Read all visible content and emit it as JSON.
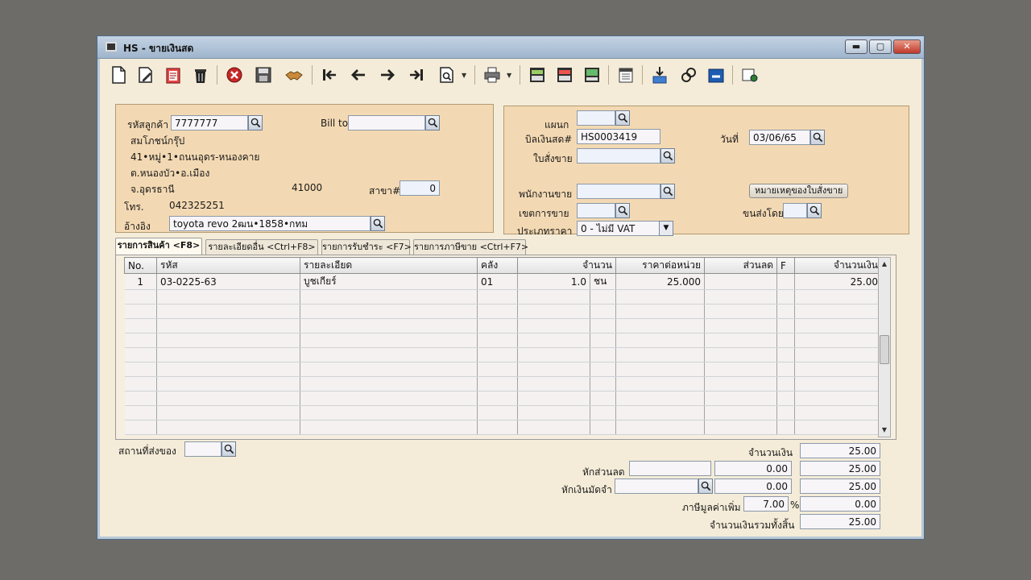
{
  "window": {
    "title": "HS - ขายเงินสด",
    "min_label": "▬",
    "max_label": "▢",
    "close_label": "✕"
  },
  "toolbar": {
    "icons": [
      "new-doc-icon",
      "edit-icon",
      "clipboard-icon",
      "trash-icon",
      "cancel-icon",
      "save-icon",
      "handshake-icon",
      "first-icon",
      "prev-icon",
      "next-icon",
      "last-icon",
      "find-icon",
      "print-icon",
      "report-1-icon",
      "report-2-icon",
      "report-3-icon",
      "calendar-icon",
      "approve-down-icon",
      "link-icon",
      "ok-icon",
      "settings-icon"
    ]
  },
  "customer": {
    "code_label": "รหัสลูกค้า",
    "code_value": "7777777",
    "name": "สมโภชน์กรุ๊ป",
    "address1": "41•หมู่•1•ถนนอุดร-หนองคาย",
    "address2": "ต.หนองบัว•อ.เมือง",
    "address3": "จ.อุดรธานี",
    "postal": "41000",
    "branch_label": "สาขา#",
    "branch_value": "0",
    "phone_label": "โทร.",
    "phone_value": "042325251",
    "bill_to_label": "Bill to",
    "bill_to_value": "",
    "ref_label": "อ้างอิง",
    "ref_value": "toyota revo 2ฒน•1858•กทม"
  },
  "invoice": {
    "dept_label": "แผนก",
    "dept_value": "",
    "bill_label": "บิลเงินสด#",
    "bill_value": "HS0003419",
    "order_label": "ใบสั่งขาย",
    "order_value": "",
    "date_label": "วันที่",
    "date_value": "03/06/65",
    "note_button": "หมายเหตุของใบสั่งขาย",
    "salesperson_label": "พนักงานขาย",
    "salesperson_value": "",
    "zone_label": "เขตการขาย",
    "zone_value": "",
    "ship_by_label": "ขนส่งโดย",
    "ship_by_value": "",
    "price_type_label": "ประเภทราคา",
    "price_type_value": "0 - ไม่มี VAT"
  },
  "tabs": [
    {
      "label": "รายการสินค้า <F8>"
    },
    {
      "label": "รายละเอียดอื่น <Ctrl+F8>"
    },
    {
      "label": "รายการรับชำระ <F7>"
    },
    {
      "label": "รายการภาษีขาย <Ctrl+F7>"
    }
  ],
  "grid": {
    "headers": {
      "no": "No.",
      "code": "รหัส",
      "desc": "รายละเอียด",
      "warehouse": "คลัง",
      "qty": "จำนวน",
      "unit_price": "ราคาต่อหน่วย",
      "discount": "ส่วนลด",
      "f": "F",
      "amount": "จำนวนเงิน"
    },
    "rows": [
      {
        "no": "1",
        "code": "03-0225-63",
        "desc": "บูชเกียร์",
        "warehouse": "01",
        "qty": "1.0",
        "unit": "ชน",
        "unit_price": "25.000",
        "discount": "",
        "f": "",
        "amount": "25.00"
      }
    ]
  },
  "footer": {
    "ship_place_label": "สถานที่ส่งของ",
    "ship_place_value": "",
    "total_label": "จำนวนเงิน",
    "total_value": "25.00",
    "discount_label": "หักส่วนลด",
    "discount_text": "",
    "discount_amount": "0.00",
    "after_discount": "25.00",
    "deposit_label": "หักเงินมัดจำ",
    "deposit_text": "",
    "deposit_amount": "0.00",
    "after_deposit": "25.00",
    "vat_label": "ภาษีมูลค่าเพิ่ม",
    "vat_rate": "7.00",
    "vat_pct": "%",
    "vat_amount": "0.00",
    "grand_label": "จำนวนเงินรวมทั้งสิ้น",
    "grand_value": "25.00"
  }
}
